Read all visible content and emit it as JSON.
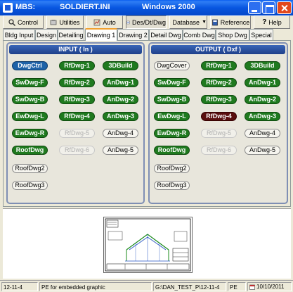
{
  "window": {
    "app_name": "MBS:",
    "ini_file": "SOLDIERT.INI",
    "os": "Windows 2000"
  },
  "toolbar": {
    "control": "Control",
    "utilities": "Utilities",
    "auto": "Auto",
    "des_dt_dwg": "Des/Dt/Dwg",
    "database": "Database",
    "reference": "Reference",
    "help": "Help"
  },
  "tabs": [
    "Bldg Input",
    "Design",
    "Detailing",
    "Drawing 1",
    "Drawing 2",
    "Detail Dwg",
    "Comb Dwg",
    "Shop Dwg",
    "Special"
  ],
  "active_tab": "Drawing 1",
  "input_panel": {
    "title": "INPUT ( In )",
    "buttons": [
      {
        "label": "DwgCtrl",
        "style": "blue"
      },
      {
        "label": "RfDwg-1",
        "style": "green"
      },
      {
        "label": "3DBuild",
        "style": "green"
      },
      {
        "label": "SwDwg-F",
        "style": "green"
      },
      {
        "label": "RfDwg-2",
        "style": "green"
      },
      {
        "label": "AnDwg-1",
        "style": "green"
      },
      {
        "label": "SwDwg-B",
        "style": "green"
      },
      {
        "label": "RfDwg-3",
        "style": "green"
      },
      {
        "label": "AnDwg-2",
        "style": "green"
      },
      {
        "label": "EwDwg-L",
        "style": "green"
      },
      {
        "label": "RfDwg-4",
        "style": "green"
      },
      {
        "label": "AnDwg-3",
        "style": "green"
      },
      {
        "label": "EwDwg-R",
        "style": "green"
      },
      {
        "label": "RfDwg-5",
        "style": "disabled"
      },
      {
        "label": "AnDwg-4",
        "style": "white"
      },
      {
        "label": "RoofDwg",
        "style": "green"
      },
      {
        "label": "RfDwg-6",
        "style": "disabled"
      },
      {
        "label": "AnDwg-5",
        "style": "white"
      },
      {
        "label": "RoofDwg2",
        "style": "white"
      },
      {
        "label": "RoofDwg3",
        "style": "white"
      }
    ]
  },
  "output_panel": {
    "title": "OUTPUT ( Dxf )",
    "buttons": [
      {
        "label": "DwgCover",
        "style": "white"
      },
      {
        "label": "RfDwg-1",
        "style": "green"
      },
      {
        "label": "3DBuild",
        "style": "green"
      },
      {
        "label": "SwDwg-F",
        "style": "green"
      },
      {
        "label": "RfDwg-2",
        "style": "green"
      },
      {
        "label": "AnDwg-1",
        "style": "green"
      },
      {
        "label": "SwDwg-B",
        "style": "green"
      },
      {
        "label": "RfDwg-3",
        "style": "green"
      },
      {
        "label": "AnDwg-2",
        "style": "green"
      },
      {
        "label": "EwDwg-L",
        "style": "green"
      },
      {
        "label": "RfDwg-4",
        "style": "dark"
      },
      {
        "label": "AnDwg-3",
        "style": "green"
      },
      {
        "label": "EwDwg-R",
        "style": "green"
      },
      {
        "label": "RfDwg-5",
        "style": "disabled"
      },
      {
        "label": "AnDwg-4",
        "style": "white"
      },
      {
        "label": "RoofDwg",
        "style": "green"
      },
      {
        "label": "RfDwg-6",
        "style": "disabled"
      },
      {
        "label": "AnDwg-5",
        "style": "white"
      },
      {
        "label": "RoofDwg2",
        "style": "white"
      },
      {
        "label": "RoofDwg3",
        "style": "white"
      }
    ]
  },
  "status": {
    "job": "12-11-4",
    "message": "PE for embedded graphic",
    "path": "G:\\DAN_TEST_P\\12-11-4",
    "user": "PE",
    "date": "10/10/2011"
  },
  "colors": {
    "title_blue": "#0856e0",
    "pill_green": "#1f7a1f",
    "pill_blue": "#1e62a8",
    "pill_dark_red": "#5a0e0e",
    "panel_header": "#1e3f8a"
  }
}
